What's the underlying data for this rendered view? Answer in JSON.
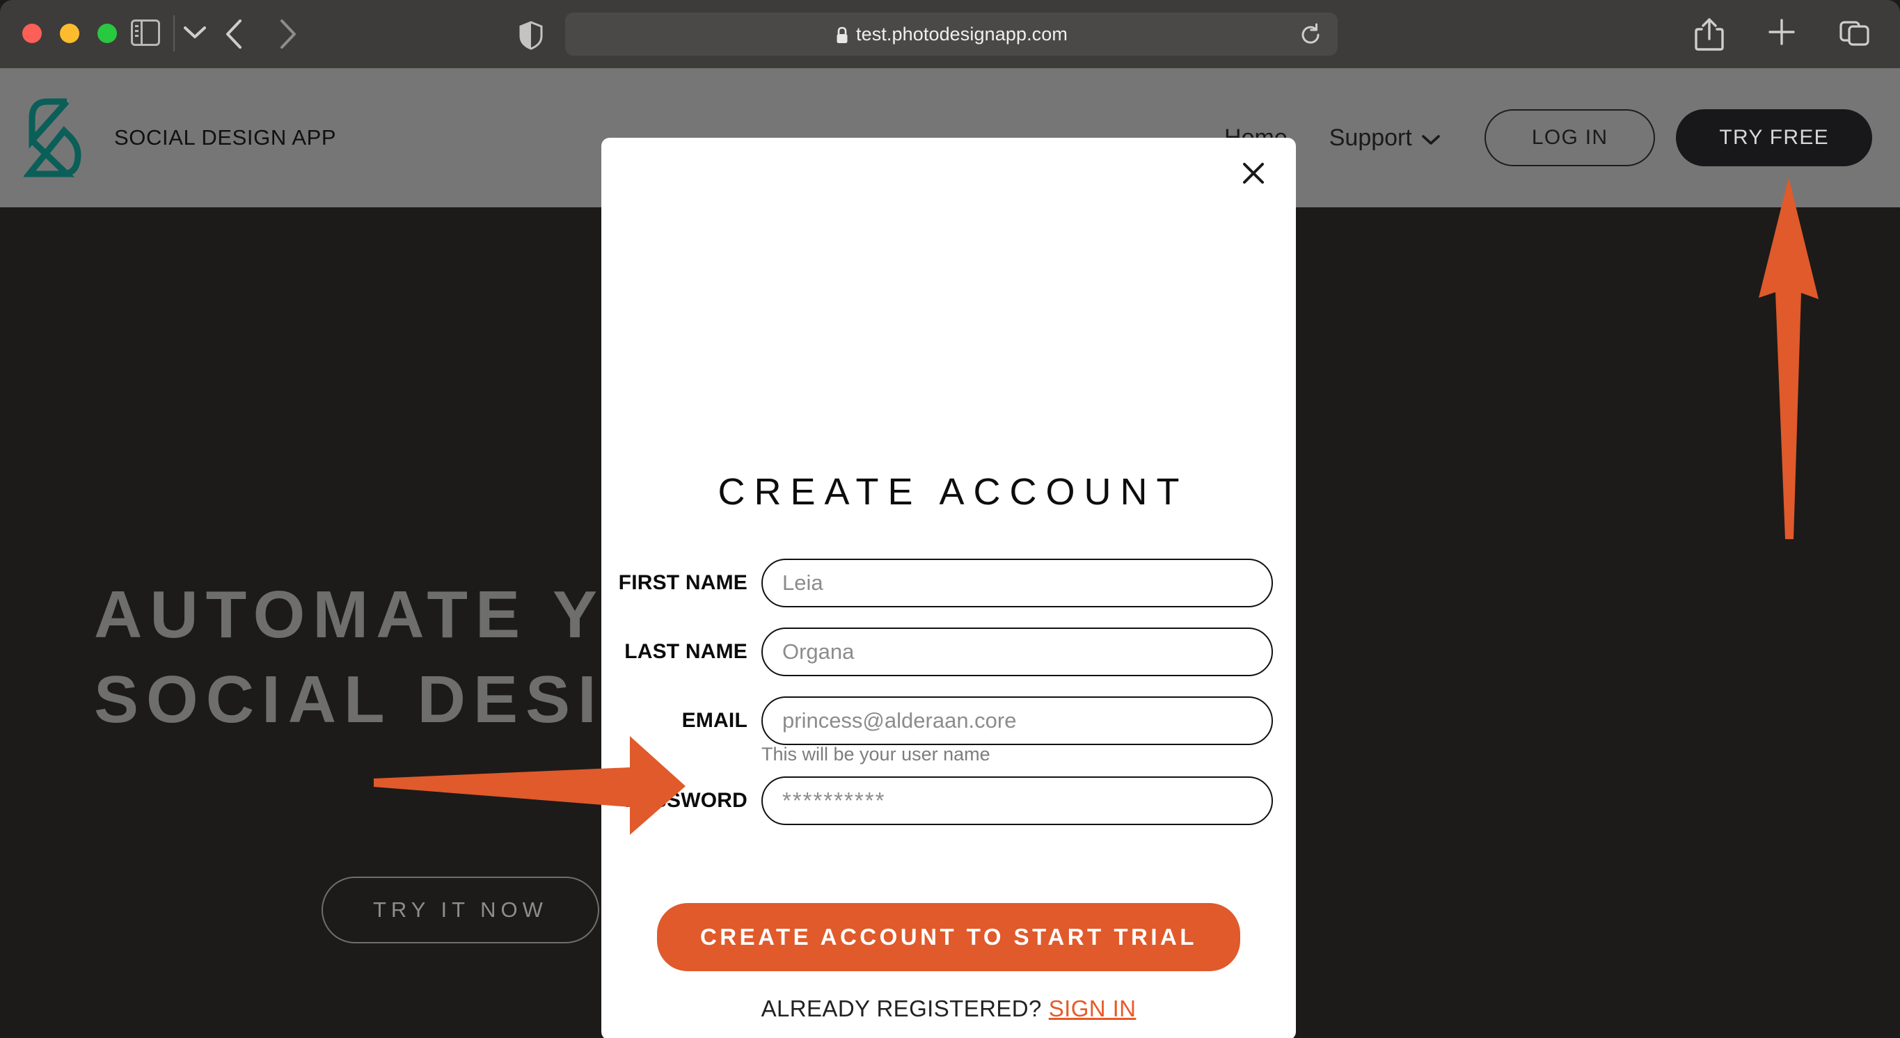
{
  "browser": {
    "url": "test.photodesignapp.com",
    "lock_icon": "lock-icon",
    "traffic_lights": [
      "close-red",
      "minimize-yellow",
      "zoom-green"
    ],
    "sidebar_icon": "sidebar-toggle-icon",
    "dropdown_icon": "chevron-down-icon",
    "back_icon": "chevron-left-icon",
    "forward_icon": "chevron-right-icon",
    "shield_icon": "privacy-shield-icon",
    "reload_icon": "reload-icon",
    "share_icon": "share-icon",
    "newtab_icon": "plus-icon",
    "tabs_icon": "tab-overview-icon"
  },
  "site": {
    "brand_name": "SOCIAL DESIGN APP",
    "logo_icon": "social-design-app-logo",
    "brand_color": "#0a5f58",
    "nav": [
      {
        "label": "Home",
        "caret": false
      },
      {
        "label": "Support",
        "caret": true
      }
    ],
    "login_label": "LOG IN",
    "tryfree_label": "TRY FREE",
    "header_bg": "#767676"
  },
  "hero": {
    "title": "AUTOMATE YOUR\nSOCIAL DESIGN",
    "cta_label": "TRY IT NOW",
    "bg": "#1c1b19",
    "text_color": "#6e6e6c"
  },
  "modal": {
    "title": "CREATE ACCOUNT",
    "close_icon": "close-icon",
    "fields": [
      {
        "label": "FIRST NAME",
        "placeholder": "Leia",
        "name": "first-name-input",
        "type": "text"
      },
      {
        "label": "LAST NAME",
        "placeholder": "Organa",
        "name": "last-name-input",
        "type": "text"
      },
      {
        "label": "EMAIL",
        "placeholder": "princess@alderaan.core",
        "name": "email-input",
        "type": "email"
      },
      {
        "label": "PASSWORD",
        "placeholder": "**********",
        "name": "password-input",
        "type": "password"
      }
    ],
    "email_hint": "This will be your user name",
    "cta_label": "CREATE ACCOUNT TO START TRIAL",
    "cta_color": "#e05a2b",
    "already_text": "ALREADY REGISTERED?",
    "signin_label": "SIGN IN",
    "signin_color": "#e85a28"
  },
  "annotations": {
    "arrow_color": "#e05a2b",
    "arrow_to_cta": "arrow-pointing-to-create-account-button",
    "arrow_to_tryfree": "arrow-pointing-to-try-free-button"
  }
}
